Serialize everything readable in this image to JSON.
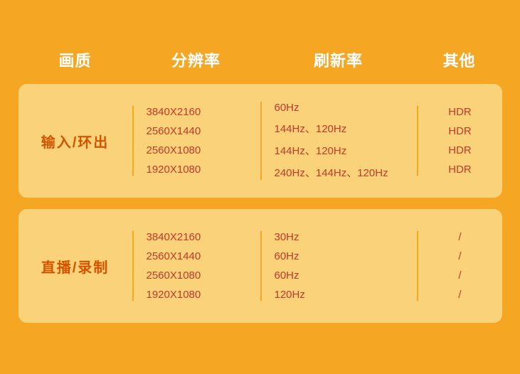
{
  "header": {
    "col1": "画质",
    "col2": "分辨率",
    "col3": "刷新率",
    "col4": "其他"
  },
  "rows": [
    {
      "label": "输入/环出",
      "resolutions": [
        "3840X2160",
        "2560X1440",
        "2560X1080",
        "1920X1080"
      ],
      "refresh_rates": [
        "60Hz",
        "144Hz、120Hz",
        "144Hz、120Hz",
        "240Hz、144Hz、120Hz"
      ],
      "others": [
        "HDR",
        "HDR",
        "HDR",
        "HDR"
      ]
    },
    {
      "label": "直播/录制",
      "resolutions": [
        "3840X2160",
        "2560X1440",
        "2560X1080",
        "1920X1080"
      ],
      "refresh_rates": [
        "30Hz",
        "60Hz",
        "60Hz",
        "120Hz"
      ],
      "others": [
        "/",
        "/",
        "/",
        "/"
      ]
    }
  ],
  "colors": {
    "background": "#f5a623",
    "card_bg": "#fad27a",
    "label_color": "#d35400",
    "cell_color": "#c0392b",
    "header_color": "#ffffff",
    "divider_color": "#f5a623"
  }
}
